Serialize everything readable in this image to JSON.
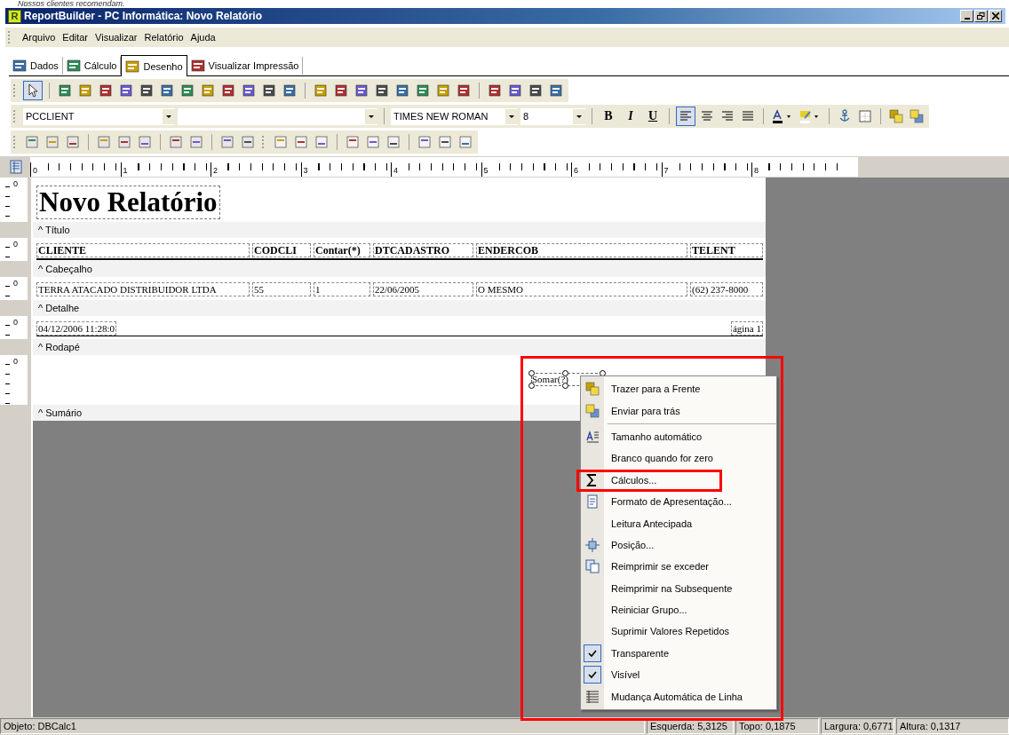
{
  "caption": "Nossos clientes recomendam.",
  "window": {
    "icon_letter": "R",
    "title": "ReportBuilder - PC Informática: Novo Relatório"
  },
  "menu": [
    "Arquivo",
    "Editar",
    "Visualizar",
    "Relatório",
    "Ajuda"
  ],
  "tabs": [
    {
      "label": "Dados",
      "selected": false
    },
    {
      "label": "Cálculo",
      "selected": false
    },
    {
      "label": "Desenho",
      "selected": true
    },
    {
      "label": "Visualizar Impressão",
      "selected": false
    }
  ],
  "toolbar": {
    "select_tool_pressed": true,
    "component_combo": "PCCLIENT",
    "font_combo": "TIMES NEW ROMAN",
    "size_combo": "8",
    "bold": "B",
    "italic": "I",
    "underline": "U",
    "align_left_pressed": true
  },
  "ruler": [
    "0",
    "1",
    "2",
    "3",
    "4",
    "5",
    "6",
    "7",
    "8"
  ],
  "report": {
    "title": "Novo Relatório",
    "bands": [
      {
        "kind": "title",
        "mark": "0",
        "label": "^  Título"
      },
      {
        "kind": "header",
        "mark": "0",
        "label": "^  Cabeçalho",
        "cells": [
          "CLIENTE",
          "CODCLI",
          "Contar(*)",
          "DTCADASTRO",
          "ENDERCOB",
          "TELENT"
        ]
      },
      {
        "kind": "detail",
        "mark": "0",
        "label": "^  Detalhe",
        "cells": [
          "TERRA ATACADO DISTRIBUIDOR LTDA",
          "55",
          "1",
          "22/06/2005",
          "O MESMO",
          "(62) 237-8000"
        ]
      },
      {
        "kind": "footer",
        "mark": "0",
        "label": "^  Rodapé",
        "left": "04/12/2006 11:28:0",
        "right": "ágina 1"
      },
      {
        "kind": "summary",
        "mark": "0",
        "label": "^  Sumário",
        "component": "Somar(?)"
      }
    ]
  },
  "context_menu": {
    "groups": [
      [
        {
          "label": "Trazer para a Frente",
          "kind": "icon",
          "checked": false,
          "highlighted": false
        },
        {
          "label": "Enviar para trás",
          "kind": "icon",
          "checked": false,
          "highlighted": false
        }
      ],
      [
        {
          "label": "Tamanho automático",
          "kind": "icon",
          "checked": false,
          "highlighted": false
        },
        {
          "label": "Branco quando for zero",
          "kind": "plain",
          "checked": false,
          "highlighted": false
        },
        {
          "label": "Cálculos...",
          "kind": "icon",
          "checked": false,
          "highlighted": true
        },
        {
          "label": "Formato de Apresentação...",
          "kind": "icon",
          "checked": false,
          "highlighted": false
        },
        {
          "label": "Leitura Antecipada",
          "kind": "plain",
          "checked": false,
          "highlighted": false
        },
        {
          "label": "Posição...",
          "kind": "icon",
          "checked": false,
          "highlighted": false
        },
        {
          "label": "Reimprimir se exceder",
          "kind": "icon",
          "checked": false,
          "highlighted": false
        },
        {
          "label": "Reimprimir na Subsequente",
          "kind": "plain",
          "checked": false,
          "highlighted": false
        },
        {
          "label": "Reiniciar Grupo...",
          "kind": "plain",
          "checked": false,
          "highlighted": false
        },
        {
          "label": "Suprimir Valores Repetidos",
          "kind": "plain",
          "checked": false,
          "highlighted": false
        },
        {
          "label": "Transparente",
          "kind": "check",
          "checked": true,
          "highlighted": false
        },
        {
          "label": "Visível",
          "kind": "check",
          "checked": true,
          "highlighted": false
        },
        {
          "label": "Mudança Automática de Linha",
          "kind": "icon",
          "checked": false,
          "highlighted": false
        }
      ]
    ]
  },
  "status_bar": {
    "object": "Objeto: DBCalc1",
    "left": "Esquerda: 5,3125",
    "top": "Topo: 0,1875",
    "width": "Largura: 0,6771",
    "height": "Altura: 0,1317"
  }
}
